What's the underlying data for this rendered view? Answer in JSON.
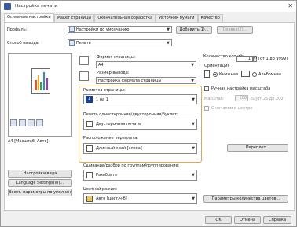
{
  "window": {
    "title": "Настройка печати",
    "close_glyph": "✕"
  },
  "tabs": [
    {
      "label": "Основные настройки",
      "active": true
    },
    {
      "label": "Макет страницы",
      "active": false
    },
    {
      "label": "Окончательная обработка",
      "active": false
    },
    {
      "label": "Источник бумаги",
      "active": false
    },
    {
      "label": "Качество",
      "active": false
    }
  ],
  "profile": {
    "label": "Профиль:",
    "value": "Настройки по умолчанию",
    "add_button": "Добавить(1)...",
    "edit_button": "Правка(2)..."
  },
  "output": {
    "label": "Способ вывода:",
    "value": "Печать"
  },
  "page_size": {
    "label": "Формат страницы:",
    "value": "A4"
  },
  "output_size": {
    "label": "Размер вывода:",
    "value": "Настройка формата страницы"
  },
  "copies": {
    "label": "Количество коп ий:",
    "value": "1",
    "range": "[от 1 до 9999]"
  },
  "orientation": {
    "label": "Ориентация",
    "portrait": "Книжная",
    "landscape": "Альбомная",
    "selected": "portrait"
  },
  "manual_scale": {
    "label": "Ручная настройка масштаба",
    "scale_label": "Масштаб:",
    "value": "100",
    "range": "% [от 25 до 200]",
    "checked": false
  },
  "center": {
    "label": "С началом в центре",
    "checked": false
  },
  "pages_per_sheet": {
    "label": "Разметка страницы:",
    "value": "1 на 1",
    "icon_text": "1"
  },
  "duplex": {
    "label": "Печать односторонняя/двусторонняя/буклет:",
    "value": "Двусторонняя печать"
  },
  "binding": {
    "label": "Расположение переплета:",
    "value": "Длинный край [слева]",
    "button": "Переплет..."
  },
  "collate": {
    "label": "Сшивание/разбор по группам/группирование:",
    "value": "Разобрать"
  },
  "color_mode": {
    "label": "Цветной режим:",
    "value": "Авто [цвет/ч-б]",
    "button": "Параметры количества цветов..."
  },
  "preview": {
    "caption": "A4 [Масштаб: Авто]",
    "bar_colors": [
      "#e4572e",
      "#f3a712",
      "#29a36a",
      "#2e86de",
      "#8e44ad"
    ]
  },
  "left_buttons": {
    "view": "Настройки вида",
    "language": "Language Settings(W)...",
    "restore": "Восст. параметры по умолчанию"
  },
  "footer": {
    "ok": "OK",
    "cancel": "Отмена",
    "help": "Справка"
  },
  "colors": {
    "highlight": "#f2a33a",
    "accent": "#1c3d8c"
  }
}
